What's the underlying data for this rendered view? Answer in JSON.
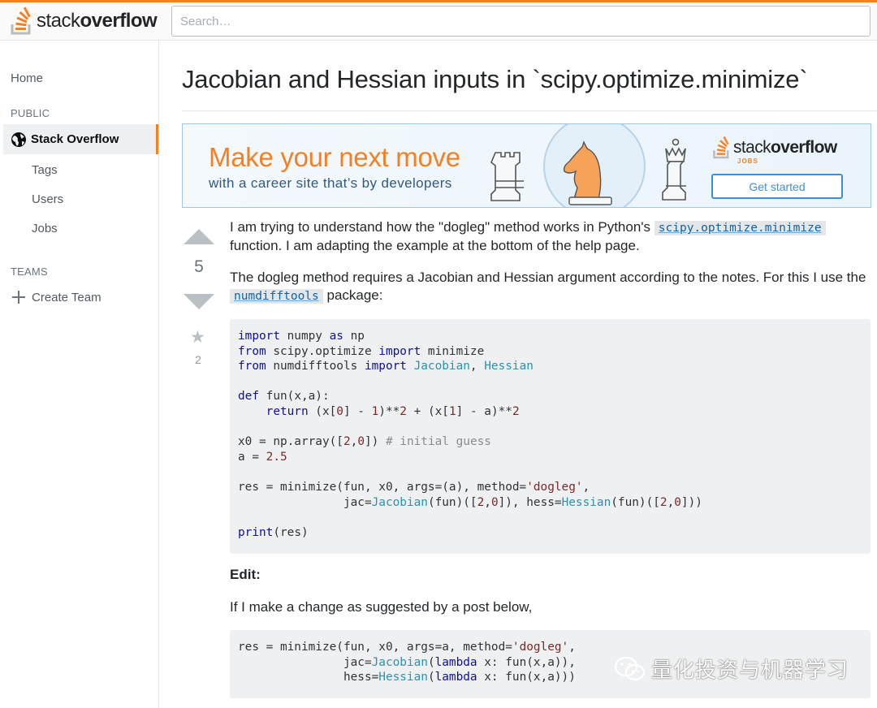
{
  "brand": {
    "logo_light": "stack",
    "logo_bold": "overflow",
    "accent": "#f48024"
  },
  "search": {
    "placeholder": "Search…"
  },
  "sidebar": {
    "home": "Home",
    "public_label": "PUBLIC",
    "active_item": "Stack Overflow",
    "items": [
      "Tags",
      "Users",
      "Jobs"
    ],
    "teams_label": "TEAMS",
    "create_team": "Create Team"
  },
  "question": {
    "title": "Jacobian and Hessian inputs in `scipy.optimize.minimize`",
    "votes": "5",
    "favorites": "2"
  },
  "ad": {
    "headline": "Make your next move",
    "subline": "with a career site that’s by developers",
    "logo_light": "stack",
    "logo_bold": "overflow",
    "jobs_tag": "JOBS",
    "button": "Get started"
  },
  "post": {
    "p1_a": "I am trying to understand how the \"dogleg\" method works in Python's ",
    "p1_code": "scipy.optimize.minimize",
    "p1_b": " function. I am adapting the example at the bottom of the help page.",
    "p2_a": "The dogleg method requires a Jacobian and Hessian argument according to the notes. For this I use the ",
    "p2_code": "numdifftools",
    "p2_b": " package:",
    "edit": "Edit:",
    "p3": "If I make a change as suggested by a post below,"
  },
  "watermark": {
    "text": "量化投资与机器学习"
  }
}
